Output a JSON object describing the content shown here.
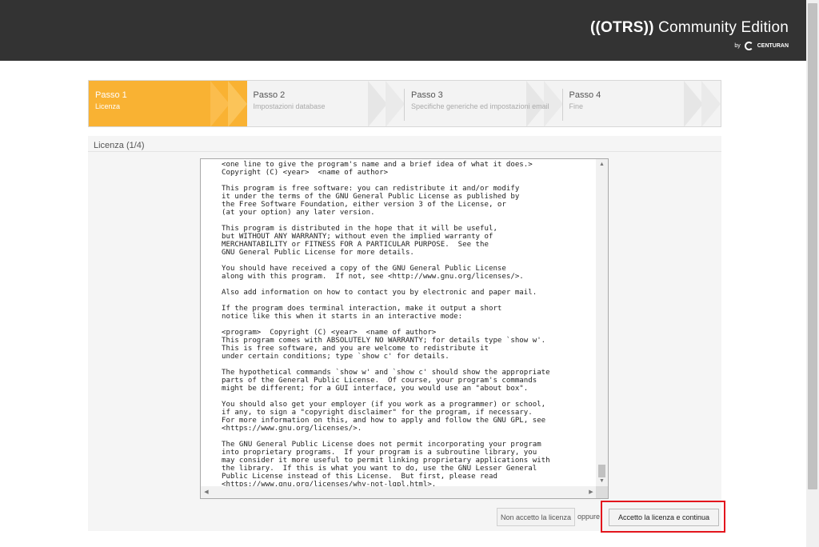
{
  "header": {
    "brand_logo": "((OTRS))",
    "brand_edition": "Community Edition",
    "brand_by": "by",
    "brand_partner": "CENTURAN"
  },
  "steps": [
    {
      "title": "Passo 1",
      "subtitle": "Licenza",
      "active": true
    },
    {
      "title": "Passo 2",
      "subtitle": "Impostazioni database",
      "active": false
    },
    {
      "title": "Passo 3",
      "subtitle": "Specifiche generiche ed impostazioni email",
      "active": false
    },
    {
      "title": "Passo 4",
      "subtitle": "Fine",
      "active": false
    }
  ],
  "panel": {
    "title": "Licenza (1/4)"
  },
  "license": {
    "text": "<one line to give the program's name and a brief idea of what it does.>\nCopyright (C) <year>  <name of author>\n\nThis program is free software: you can redistribute it and/or modify\nit under the terms of the GNU General Public License as published by\nthe Free Software Foundation, either version 3 of the License, or\n(at your option) any later version.\n\nThis program is distributed in the hope that it will be useful,\nbut WITHOUT ANY WARRANTY; without even the implied warranty of\nMERCHANTABILITY or FITNESS FOR A PARTICULAR PURPOSE.  See the\nGNU General Public License for more details.\n\nYou should have received a copy of the GNU General Public License\nalong with this program.  If not, see <http://www.gnu.org/licenses/>.\n\nAlso add information on how to contact you by electronic and paper mail.\n\nIf the program does terminal interaction, make it output a short\nnotice like this when it starts in an interactive mode:\n\n<program>  Copyright (C) <year>  <name of author>\nThis program comes with ABSOLUTELY NO WARRANTY; for details type `show w'.\nThis is free software, and you are welcome to redistribute it\nunder certain conditions; type `show c' for details.\n\nThe hypothetical commands `show w' and `show c' should show the appropriate\nparts of the General Public License.  Of course, your program's commands\nmight be different; for a GUI interface, you would use an \"about box\".\n\nYou should also get your employer (if you work as a programmer) or school,\nif any, to sign a \"copyright disclaimer\" for the program, if necessary.\nFor more information on this, and how to apply and follow the GNU GPL, see\n<https://www.gnu.org/licenses/>.\n\nThe GNU General Public License does not permit incorporating your program\ninto proprietary programs.  If your program is a subroutine library, you\nmay consider it more useful to permit linking proprietary applications with\nthe library.  If this is what you want to do, use the GNU Lesser General\nPublic License instead of this License.  But first, please read\n<https://www.gnu.org/licenses/why-not-lgpl.html>."
  },
  "actions": {
    "reject_label": "Non accetto la licenza",
    "or_label": "oppure",
    "accept_label": "Accetto la licenza e continua"
  },
  "colors": {
    "header_bg": "#333333",
    "active_step": "#f9b233",
    "highlight_border": "#e3151d"
  },
  "icons": {
    "scroll_up": "▲",
    "scroll_down": "▼",
    "scroll_left": "◀",
    "scroll_right": "▶"
  }
}
